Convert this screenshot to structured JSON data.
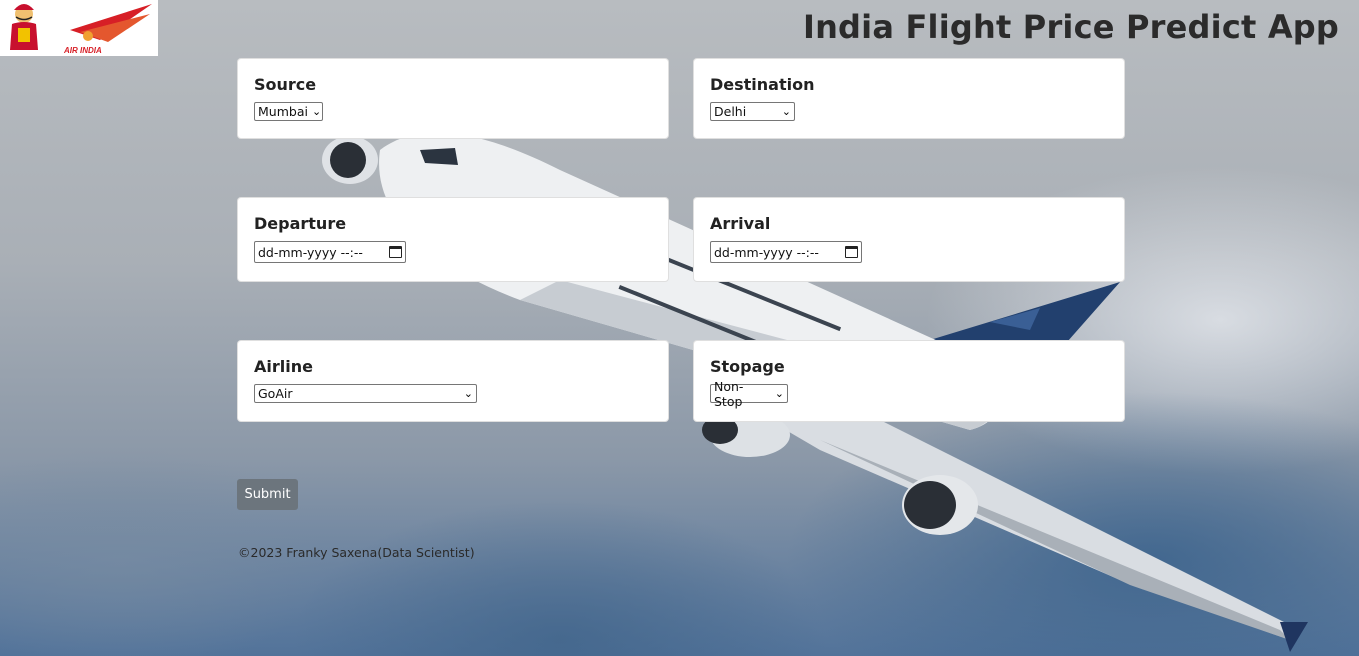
{
  "app": {
    "title": "India Flight Price Predict App"
  },
  "form": {
    "source": {
      "label": "Source",
      "value": "Mumbai"
    },
    "destination": {
      "label": "Destination",
      "value": "Delhi"
    },
    "departure": {
      "label": "Departure",
      "placeholder": "dd-mm-yyyy --:--"
    },
    "arrival": {
      "label": "Arrival",
      "placeholder": "dd-mm-yyyy --:--"
    },
    "airline": {
      "label": "Airline",
      "value": "GoAir"
    },
    "stopage": {
      "label": "Stopage",
      "value": "Non-Stop"
    },
    "submit_label": "Submit"
  },
  "footer": {
    "text": "©2023 Franky Saxena(Data Scientist)"
  },
  "icons": {
    "select_arrow": "chevron-down-icon",
    "date_picker": "calendar-icon"
  },
  "colors": {
    "submit_bg": "#6c757d",
    "logo_red": "#d71f26"
  }
}
